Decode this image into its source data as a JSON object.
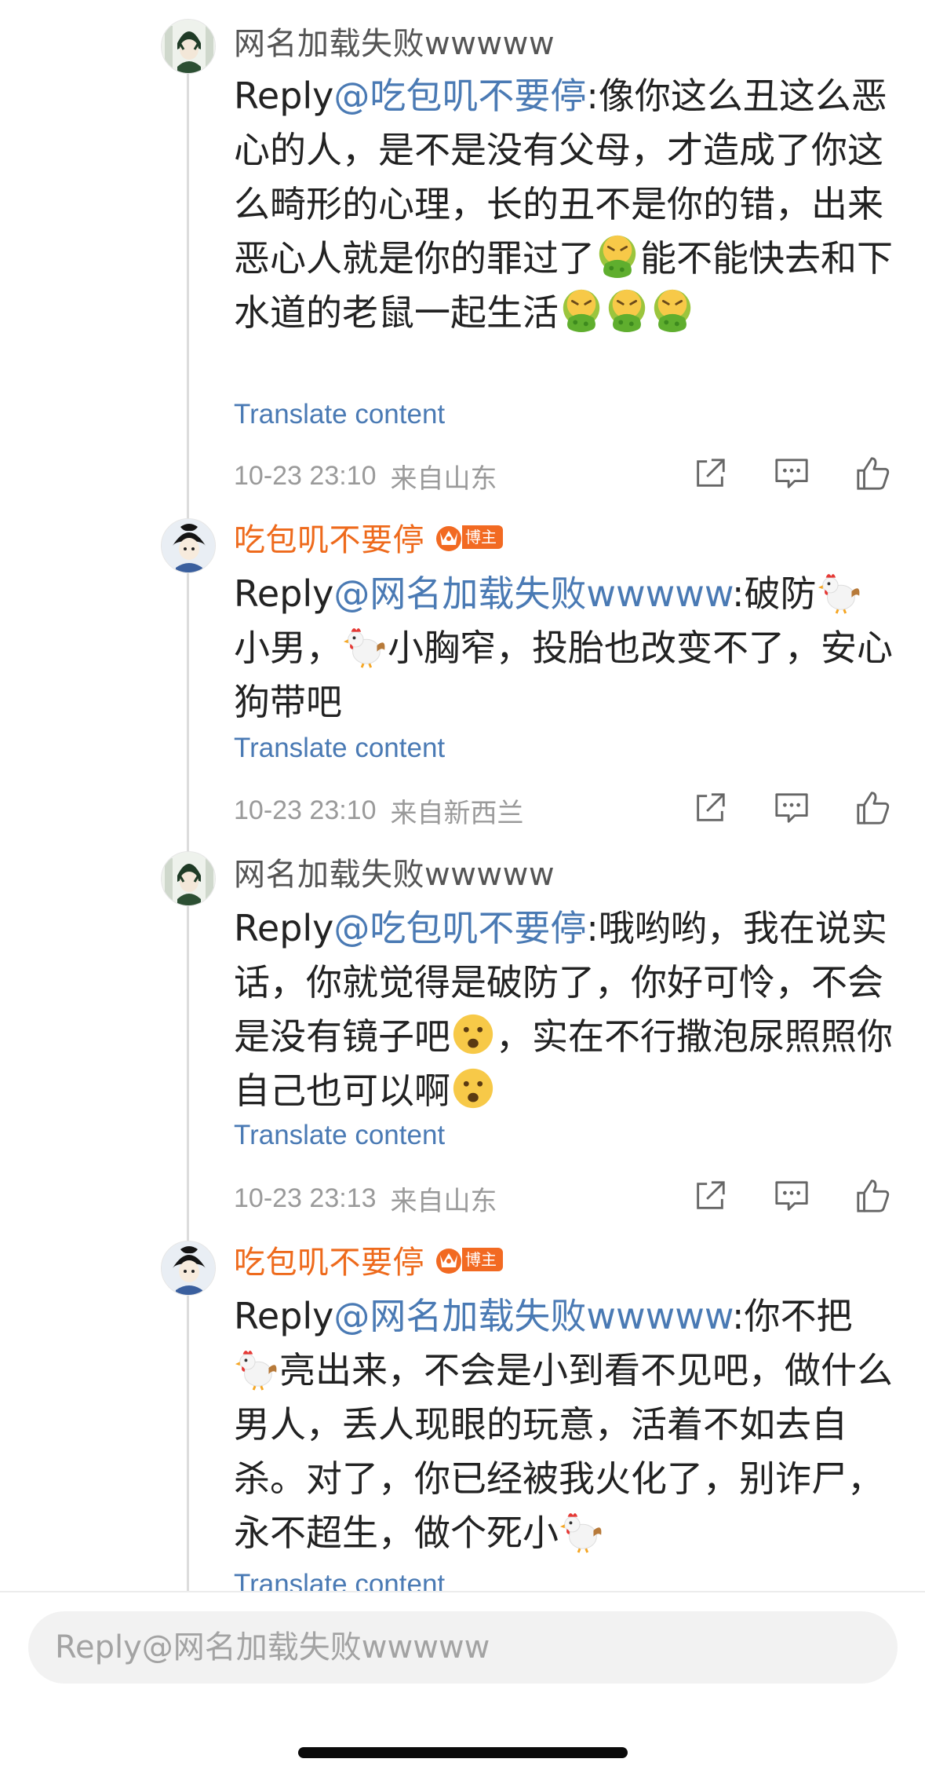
{
  "comments": [
    {
      "username": "网名加载失败wwwww",
      "reply_prefix": "Reply",
      "mention": "@吃包叽不要停",
      "text_1": ":像你这么丑这么恶心的人，是不是没有父母，才造成了你这么畸形的心理，长的丑不是你的错，出来恶心人就是你的罪过了",
      "text_2": "能不能快去和下水道的老鼠一起生活",
      "translate": "Translate content",
      "time": "10-23 23:10",
      "location": "来自山东"
    },
    {
      "username": "吃包叽不要停",
      "badge": "博主",
      "reply_prefix": "Reply",
      "mention": "@网名加载失败wwwww",
      "text_1": ":破防",
      "text_2": "小男，",
      "text_3": "小胸窄，投胎也改变不了，安心狗带吧",
      "translate": "Translate content",
      "time": "10-23 23:10",
      "location": "来自新西兰"
    },
    {
      "username": "网名加载失败wwwww",
      "reply_prefix": "Reply",
      "mention": "@吃包叽不要停",
      "text_1": ":哦哟哟，我在说实话，你就觉得是破防了，你好可怜，不会是没有镜子吧",
      "text_2": "，实在不行撒泡尿照照你自己也可以啊",
      "translate": "Translate content",
      "time": "10-23 23:13",
      "location": "来自山东"
    },
    {
      "username": "吃包叽不要停",
      "badge": "博主",
      "reply_prefix": "Reply",
      "mention": "@网名加载失败wwwww",
      "text_1": ":你不把",
      "text_2": "亮出来，不会是小到看不见吧，做什么男人，丢人现眼的玩意，活着不如去自杀。对了，你已经被我火化了，别诈尸，永不超生，做个死小",
      "translate": "Translate content"
    }
  ],
  "reply_input": {
    "placeholder": "Reply@网名加载失败wwwww"
  },
  "icons": {
    "share": "share-icon",
    "comment": "comment-icon",
    "like": "like-icon",
    "vomit_emoji": "vomit-emoji-icon",
    "rooster_emoji": "rooster-emoji-icon",
    "frown_emoji": "frown-emoji-icon"
  },
  "colors": {
    "mention": "#4a7ab4",
    "blogger_name": "#ee6a1c",
    "meta": "#9a9a9a"
  }
}
